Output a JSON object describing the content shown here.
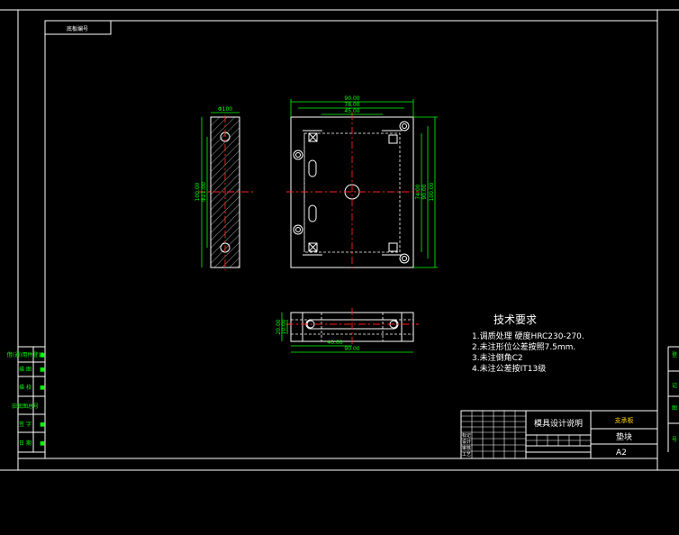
{
  "stamp_label": "底板编号",
  "side_view": {
    "top_dim": "Φ100",
    "side_dim_1": "100.00",
    "side_dim_2": "Φ21.00"
  },
  "top_view": {
    "dim_overall_width": "90.00",
    "dim_inner_width": "78.00",
    "dim_slot_width": "45.00",
    "dim_height_1": "74.00",
    "dim_height_2": "90.00",
    "dim_height_3": "100.00"
  },
  "bottom_view": {
    "dim_thick_1": "20.00",
    "dim_thick_2": "10.00",
    "dim_length_1": "40.00",
    "dim_length_2": "90.00"
  },
  "requirements": {
    "title": "技术要求",
    "items": [
      "1.调质处理 硬度HRC230-270.",
      "2.未注形位公差按照7.5mm.",
      "3.未注倒角C2",
      "4.未注公差按IT13级"
    ]
  },
  "title_block": {
    "part_name": "垫块",
    "drawing_no": "支承板",
    "material": "A2",
    "school": "模具设计说明",
    "row_labels": [
      "标记",
      "设计",
      "审核",
      "工艺"
    ]
  },
  "left_margin_labels": [
    "借(通)用件登记",
    "描 图",
    "描 校",
    "旧底图总号",
    "签 字",
    "日 期"
  ],
  "right_margin_labels": [
    "登",
    "记",
    "图",
    "号"
  ]
}
